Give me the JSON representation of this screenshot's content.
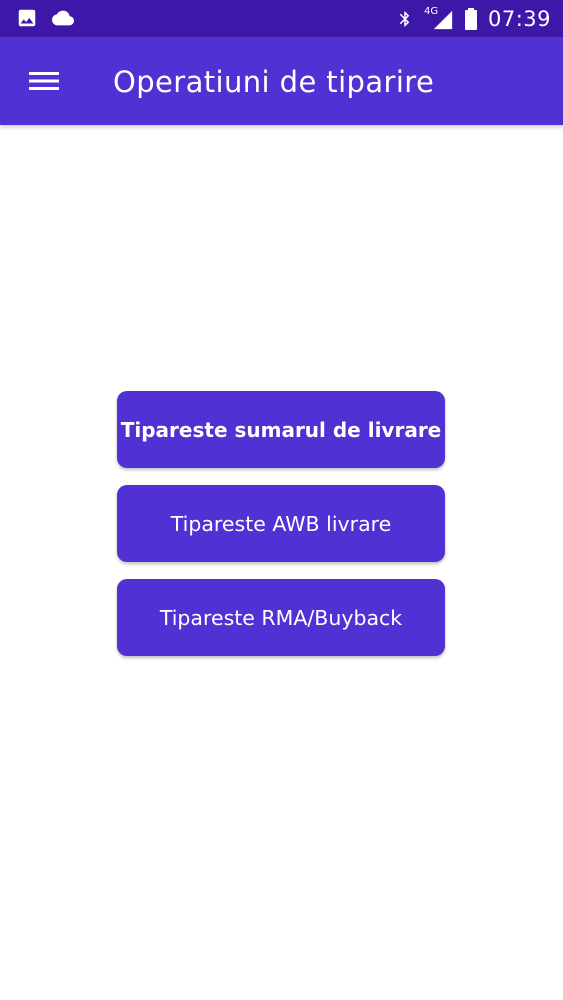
{
  "status_bar": {
    "time": "07:39",
    "network_type": "4G",
    "icons": [
      "image-icon",
      "cloud-icon",
      "bluetooth-icon",
      "signal-icon",
      "battery-icon"
    ],
    "background_color": "#3d17a8"
  },
  "app_bar": {
    "menu_icon": "menu-icon",
    "title": "Operatiuni de tiparire",
    "background_color": "#5130d4"
  },
  "actions": {
    "print_delivery_summary": "Tipareste sumarul de livrare",
    "print_awb_delivery": "Tipareste AWB livrare",
    "print_rma_buyback": "Tipareste RMA/Buyback"
  }
}
